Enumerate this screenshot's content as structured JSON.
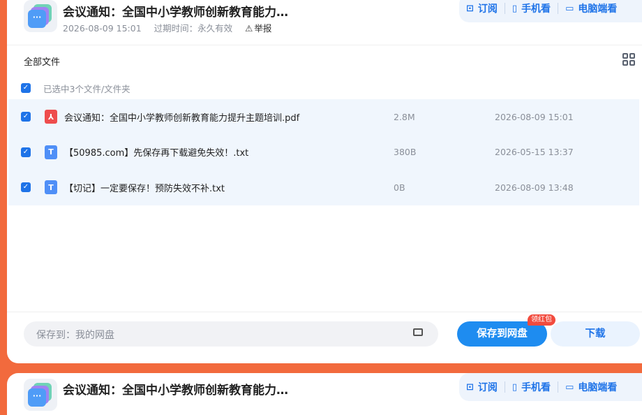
{
  "header": {
    "title": "会议通知：全国中小学教师创新教育能力提…",
    "date": "2026-08-09 15:01",
    "expire_label": "过期时间：永久有效",
    "report_label": "举报",
    "actions": [
      {
        "label": "订阅",
        "icon": "bookmark-icon"
      },
      {
        "label": "手机看",
        "icon": "phone-icon"
      },
      {
        "label": "电脑端看",
        "icon": "monitor-icon"
      }
    ]
  },
  "files": {
    "section_label": "全部文件",
    "selected_label": "已选中3个文件/文件夹",
    "items": [
      {
        "name": "会议通知：全国中小学教师创新教育能力提升主题培训.pdf",
        "type": "pdf",
        "type_glyph": "⅄",
        "size": "2.8M",
        "date": "2026-08-09 15:01"
      },
      {
        "name": "【50985.com】先保存再下载避免失效！.txt",
        "type": "txt",
        "type_glyph": "T",
        "size": "380B",
        "date": "2026-05-15 13:37"
      },
      {
        "name": "【切记】一定要保存！预防失效不补.txt",
        "type": "txt",
        "type_glyph": "T",
        "size": "0B",
        "date": "2026-08-09 13:48"
      }
    ]
  },
  "footer": {
    "save_path": "保存到：我的网盘",
    "save_button": "保存到网盘",
    "badge": "领红包",
    "download_button": "下载"
  },
  "second_card": {
    "title": "会议通知：全国中小学教师创新教育能力提…"
  },
  "colors": {
    "accent": "#1e73e8",
    "background": "#f26a3d",
    "selected_row": "#f0f6fd"
  }
}
